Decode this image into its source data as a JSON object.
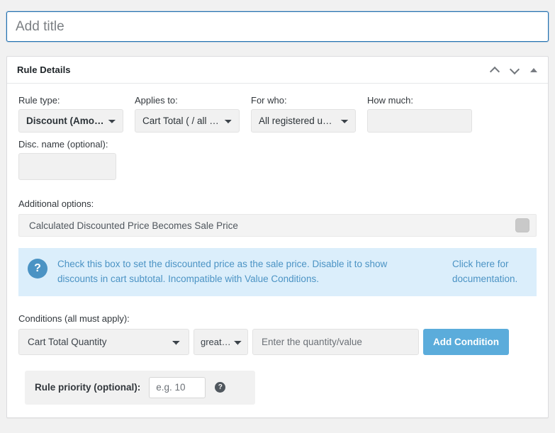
{
  "title_input": {
    "placeholder": "Add title",
    "value": ""
  },
  "panel": {
    "heading": "Rule Details",
    "actions": {
      "move_up": "Move up",
      "move_down": "Move down",
      "toggle": "Toggle panel"
    }
  },
  "fields": {
    "rule_type": {
      "label": "Rule type:",
      "value": "Discount (Amount)",
      "options": [
        "Discount (Amount)"
      ]
    },
    "applies_to": {
      "label": "Applies to:",
      "value": "Cart Total ( / all pr…",
      "options": [
        "Cart Total ( / all pr…"
      ]
    },
    "for_who": {
      "label": "For who:",
      "value": "All registered users",
      "options": [
        "All registered users"
      ]
    },
    "how_much": {
      "label": "How much:",
      "value": "",
      "placeholder": ""
    },
    "disc_name": {
      "label": "Disc. name (optional):",
      "value": "",
      "placeholder": ""
    }
  },
  "additional_options": {
    "label": "Additional options:",
    "option_label": "Calculated Discounted Price Becomes Sale Price",
    "toggle_state": "off"
  },
  "notice": {
    "icon": "question-mark",
    "text": "Check this box to set the discounted price as the sale price. Disable it to show discounts in cart subtotal. Incompatible with Value Conditions.",
    "link_text": "Click here for documentation."
  },
  "conditions": {
    "label": "Conditions (all must apply):",
    "field": {
      "value": "Cart Total Quantity",
      "options": [
        "Cart Total Quantity"
      ]
    },
    "operator": {
      "value": "greater (",
      "options": [
        "greater ("
      ]
    },
    "value_input": {
      "value": "",
      "placeholder": "Enter the quantity/value"
    },
    "add_button": "Add Condition"
  },
  "priority": {
    "label": "Rule priority (optional):",
    "value": "",
    "placeholder": "e.g. 10",
    "help_icon": "help-question-icon"
  },
  "colors": {
    "accent_blue": "#5bacdb",
    "focus_border": "#2271b1",
    "notice_bg": "#dbeefb",
    "notice_text": "#4b93c4",
    "page_bg": "#f1f1f1",
    "field_bg": "#f1f1f1"
  }
}
